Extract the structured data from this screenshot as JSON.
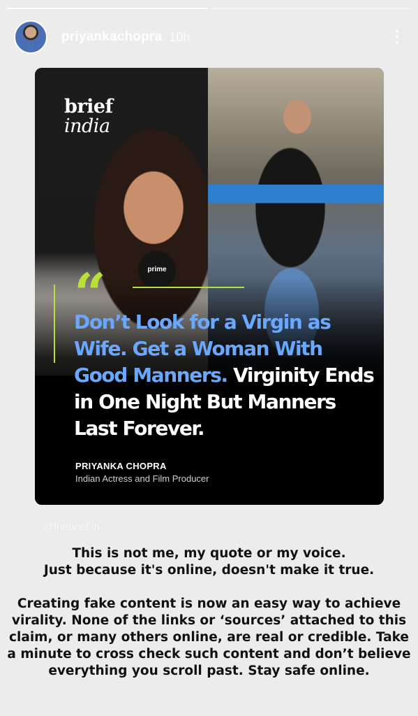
{
  "story": {
    "progress": [
      1.0,
      0.0
    ],
    "username": "priyankachopra",
    "time": "10h"
  },
  "card": {
    "brand_line1": "brief",
    "brand_line2": "india",
    "mic_label": "prime",
    "quote_mark": "“",
    "quote_highlight": "Don’t Look for a Virgin as Wife. Get a Woman With Good Manners.",
    "quote_rest": " Virginity Ends in One Night But Manners Last Forever.",
    "speaker_name": "PRIYANKA CHOPRA",
    "speaker_role": "Indian Actress and Film Producer"
  },
  "watermark": "@thebrief.in",
  "caption": {
    "line1": "This is not me, my quote or my voice.",
    "line2": "Just because it's online, doesn't make it true.",
    "paragraph": "Creating fake content is now an easy way to achieve virality. None of the links or ‘sources’ attached to this claim, or many others online, are real or credible. Take a minute to cross check such content and don’t believe everything you scroll past. Stay safe online."
  },
  "colors": {
    "accent_green": "#b8e03a",
    "highlight_blue": "#6aa8ff",
    "background": "#ececec"
  }
}
